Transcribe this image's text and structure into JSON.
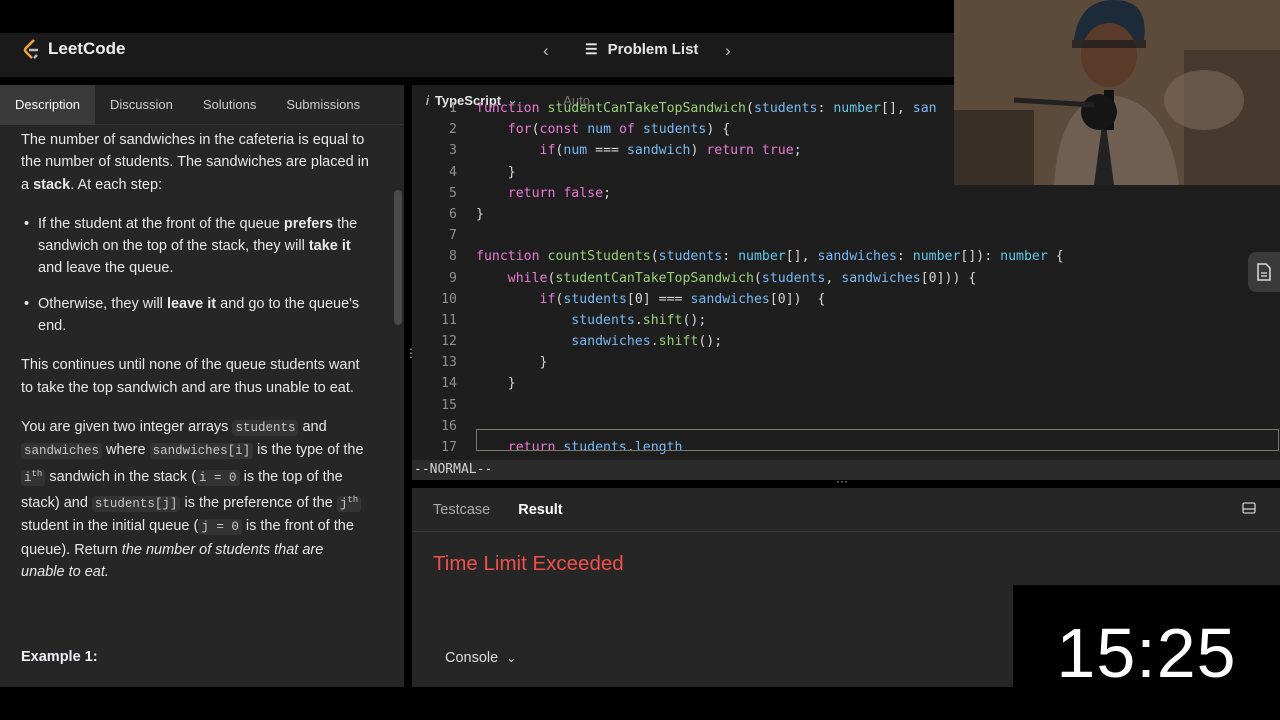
{
  "app": {
    "name": "LeetCode"
  },
  "header": {
    "problem_list": "Problem List"
  },
  "tabs": [
    "Description",
    "Discussion",
    "Solutions",
    "Submissions"
  ],
  "description": {
    "p1_a": "The number of sandwiches in the cafeteria is equal to the number of students. The sandwiches are placed in a ",
    "p1_b": "stack",
    "p1_c": ". At each step:",
    "li1_a": "If the student at the front of the queue ",
    "li1_b": "prefers",
    "li1_c": " the sandwich on the top of the stack, they will ",
    "li1_d": "take it",
    "li1_e": " and leave the queue.",
    "li2_a": "Otherwise, they will ",
    "li2_b": "leave it",
    "li2_c": " and go to the queue's end.",
    "p2": "This continues until none of the queue students want to take the top sandwich and are thus unable to eat.",
    "p3_a": "You are given two integer arrays ",
    "c_students": "students",
    "p3_b": " and ",
    "c_sandwiches": "sandwiches",
    "p3_c": " where ",
    "c_sandwiches_i": "sandwiches[i]",
    "p3_d": " is the type of the ",
    "c_i": "i",
    "sup_th": "th",
    "p3_e": " sandwich in the stack (",
    "c_i0": "i = 0",
    "p3_f": " is the top of the stack) and ",
    "c_students_j": "students[j]",
    "p3_g": " is the preference of the ",
    "c_j": "j",
    "p3_h": " student in the initial queue (",
    "c_j0": "j = 0",
    "p3_i": " is the front of the queue). Return ",
    "p3_j": "the number of students that are unable to eat.",
    "example": "Example 1:"
  },
  "editor": {
    "language": "TypeScript",
    "auto": "Auto",
    "mode": "--NORMAL--",
    "line_numbers": [
      "1",
      "2",
      "3",
      "4",
      "5",
      "6",
      "7",
      "8",
      "9",
      "10",
      "11",
      "12",
      "13",
      "14",
      "15",
      "16",
      "17"
    ]
  },
  "result": {
    "tabs": [
      "Testcase",
      "Result"
    ],
    "status": "Time Limit Exceeded",
    "console": "Console"
  },
  "timer": "15:25",
  "colors": {
    "error": "#f0504a",
    "keyword": "#e87ad4",
    "function": "#9ad17b",
    "type": "#62c7e6"
  }
}
